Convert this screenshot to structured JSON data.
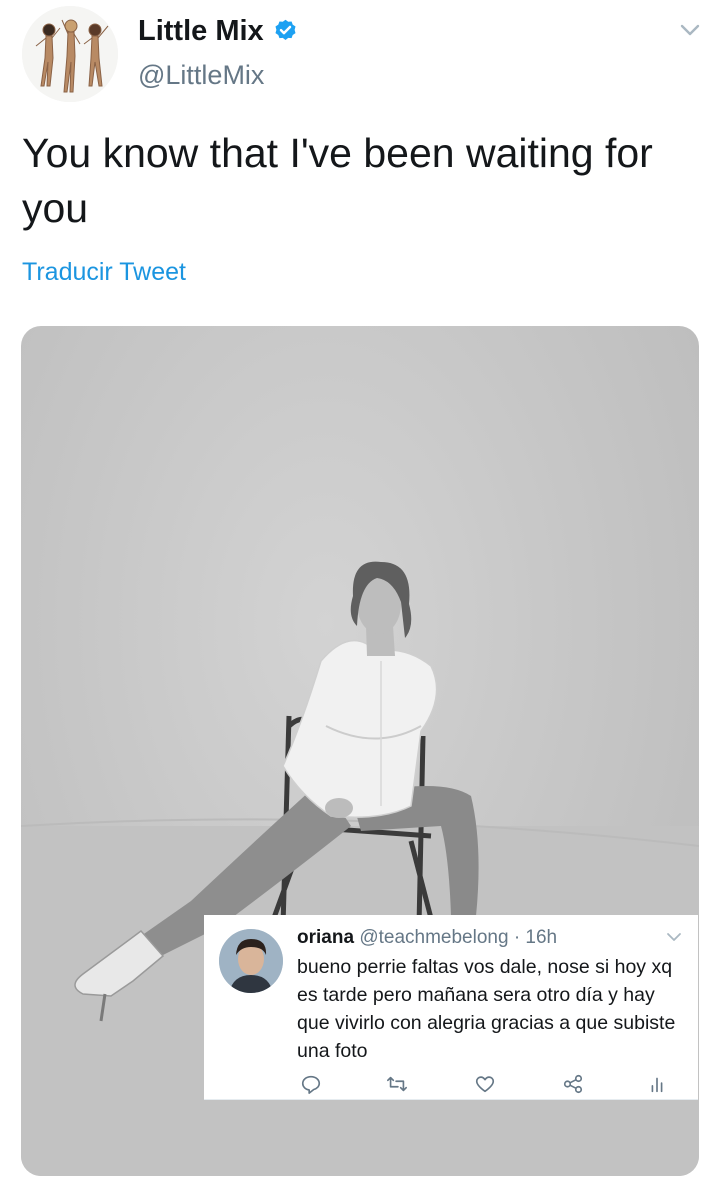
{
  "tweet": {
    "author_name": "Little Mix",
    "author_handle": "@LittleMix",
    "verified": true,
    "text": "You know that I've been waiting for you",
    "translate_link": "Traducir Tweet"
  },
  "embedded_reply": {
    "name": "oriana",
    "handle": "@teachmebelong",
    "separator": "·",
    "time": "16h",
    "text": "bueno perrie faltas vos dale, nose si hoy xq es tarde pero  mañana sera otro día y hay que vivirlo con alegria gracias a que subiste una foto",
    "actions": [
      "reply-icon",
      "retweet-icon",
      "like-icon",
      "share-icon",
      "analytics-icon"
    ]
  },
  "colors": {
    "text": "#14171a",
    "secondary": "#657786",
    "link": "#1b95e0",
    "verified": "#1da1f2"
  }
}
